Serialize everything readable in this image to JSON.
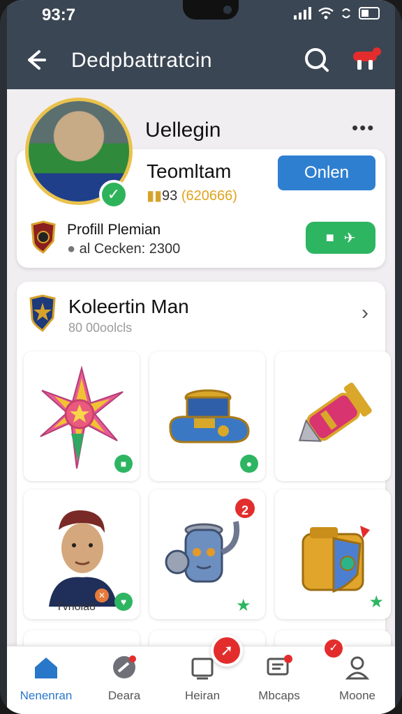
{
  "status_bar": {
    "time": "93:7"
  },
  "header": {
    "title": "Dedpbattratcin"
  },
  "profile": {
    "name": "Uellegin",
    "team_name": "Teomltam",
    "points_count": "93",
    "points_value": "(620666)",
    "online_label": "Onlen",
    "profile_label": "Profill Plemian",
    "gold_count": "al Cecken: 2300"
  },
  "collection": {
    "title": "Koleertin Man",
    "subtitle": "80 00oolcls",
    "items": [
      {
        "name": "star-emblem"
      },
      {
        "name": "armor-boot"
      },
      {
        "name": "rocket-part"
      },
      {
        "name": "player-portrait",
        "caption": "Tvriola8"
      },
      {
        "name": "robot-jug",
        "badge": "2"
      },
      {
        "name": "shield-pack"
      }
    ]
  },
  "bottom_nav": [
    {
      "label": "Nenenran",
      "icon": "home-icon",
      "active": true
    },
    {
      "label": "Deara",
      "icon": "compass-icon"
    },
    {
      "label": "Heiran",
      "icon": "box-icon"
    },
    {
      "label": "Mbcaps",
      "icon": "chat-icon"
    },
    {
      "label": "Moone",
      "icon": "user-icon"
    }
  ],
  "colors": {
    "header_bg": "#3b4654",
    "accent_blue": "#2f7fd1",
    "accent_green": "#2eb562",
    "accent_red": "#e32d2d",
    "gold": "#e9c24d"
  }
}
